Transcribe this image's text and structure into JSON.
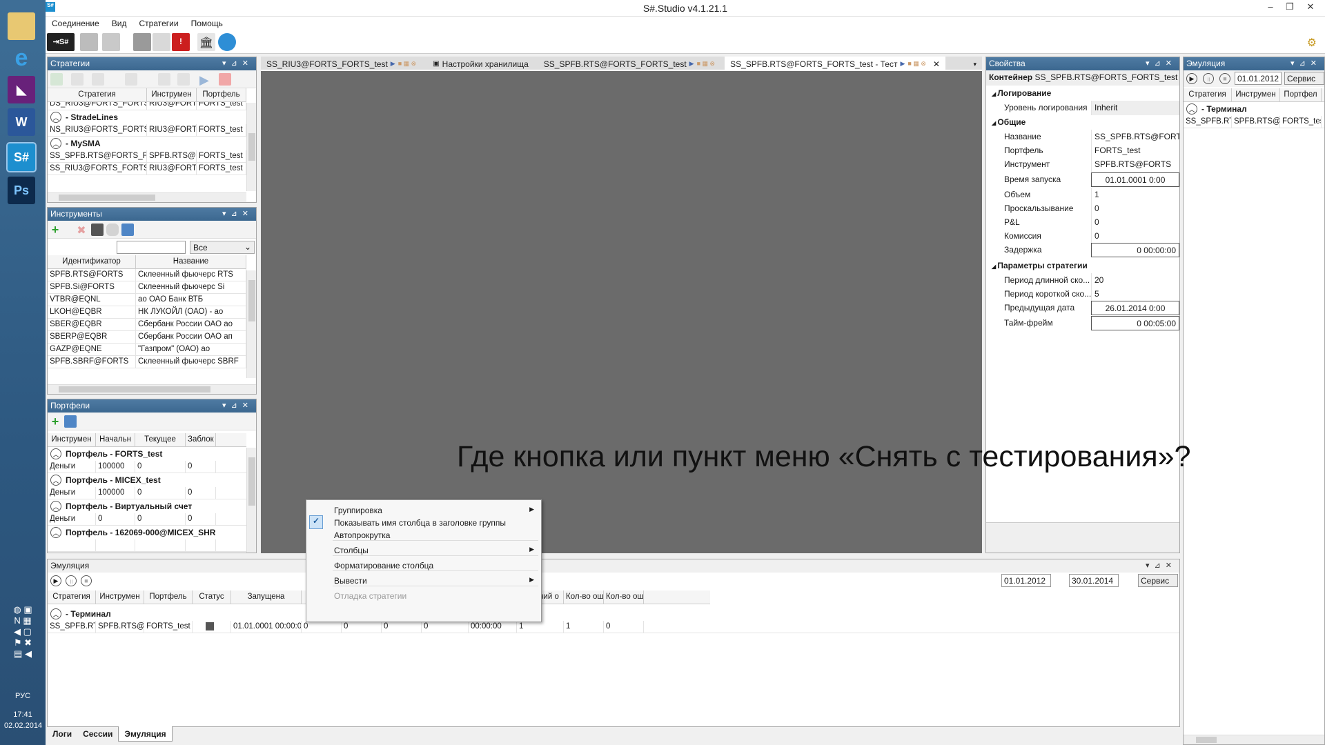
{
  "window": {
    "title": "S#.Studio v4.1.21.1"
  },
  "menu": [
    "Соединение",
    "Вид",
    "Стратегии",
    "Помощь"
  ],
  "taskbar": {
    "lang": "РУС",
    "time": "17:41",
    "date": "02.02.2014",
    "apps": [
      "file-explorer-icon",
      "ie-icon",
      "visual-studio-icon",
      "word-icon",
      "stocksharp-icon",
      "photoshop-icon"
    ],
    "app_labels": {
      "word": "W",
      "stocksharp": "S#",
      "photoshop": "Ps",
      "vs": "◣"
    }
  },
  "strategies": {
    "title": "Стратегии",
    "columns": [
      "Стратегия",
      "Инструмен",
      "Портфель"
    ],
    "rows_top": [
      [
        "DS_RIU3@FORTS_FORTS_",
        "RIU3@FORT",
        "FORTS_test"
      ]
    ],
    "groups": [
      {
        "name": "- StradeLines",
        "rows": [
          [
            "NS_RIU3@FORTS_FORTS_",
            "RIU3@FORT",
            "FORTS_test"
          ]
        ]
      },
      {
        "name": "- MySMA",
        "rows": [
          [
            "SS_SPFB.RTS@FORTS_FOF",
            "SPFB.RTS@F",
            "FORTS_test"
          ],
          [
            "SS_RIU3@FORTS_FORTS_t",
            "RIU3@FORT",
            "FORTS_test"
          ]
        ]
      }
    ]
  },
  "instruments": {
    "title": "Инструменты",
    "filter_value": "Все",
    "columns": [
      "Идентификатор",
      "Название"
    ],
    "rows": [
      [
        "SPFB.RTS@FORTS",
        "Склеенный фьючерс RTS"
      ],
      [
        "SPFB.Si@FORTS",
        "Склеенный фьючерс Si"
      ],
      [
        "VTBR@EQNL",
        "ао ОАО Банк ВТБ"
      ],
      [
        "LKOH@EQBR",
        "НК ЛУКОЙЛ (ОАО) - ао"
      ],
      [
        "SBER@EQBR",
        "Сбербанк России ОАО ао"
      ],
      [
        "SBERP@EQBR",
        "Сбербанк России ОАО ап"
      ],
      [
        "GAZP@EQNE",
        "\"Газпром\" (ОАО) ао"
      ],
      [
        "SPFB.SBRF@FORTS",
        "Склеенный фьючерс SBRF"
      ]
    ]
  },
  "portfolios": {
    "title": "Портфели",
    "columns": [
      "Инструмен",
      "Начальн",
      "Текущее",
      "Заблок"
    ],
    "groups": [
      {
        "name": "Портфель - FORTS_test",
        "row": [
          "Деньги",
          "100000",
          "0",
          "0"
        ]
      },
      {
        "name": "Портфель - MICEX_test",
        "row": [
          "Деньги",
          "100000",
          "0",
          "0"
        ]
      },
      {
        "name": "Портфель - Виртуальный счет",
        "row": [
          "Деньги",
          "0",
          "0",
          "0"
        ]
      },
      {
        "name": "Портфель - 162069-000@MICEX_SHR",
        "row": [
          "",
          "",
          "",
          ""
        ]
      }
    ]
  },
  "doc_tabs": [
    {
      "label": "SS_RIU3@FORTS_FORTS_test",
      "active": false
    },
    {
      "label": "Настройки хранилища",
      "active": false
    },
    {
      "label": "SS_SPFB.RTS@FORTS_FORTS_test",
      "active": false
    },
    {
      "label": "SS_SPFB.RTS@FORTS_FORTS_test - Тест",
      "active": true
    }
  ],
  "properties": {
    "title": "Свойства",
    "container_label": "Контейнер",
    "container_value": "SS_SPFB.RTS@FORTS_FORTS_test - Тес",
    "sections": [
      {
        "name": "Логирование",
        "items": [
          {
            "k": "Уровень логирования",
            "v": "Inherit"
          }
        ]
      },
      {
        "name": "Общие",
        "items": [
          {
            "k": "Название",
            "v": "SS_SPFB.RTS@FORTS_"
          },
          {
            "k": "Портфель",
            "v": "FORTS_test"
          },
          {
            "k": "Инструмент",
            "v": "SPFB.RTS@FORTS"
          },
          {
            "k": "Время запуска",
            "v": "01.01.0001 0:00"
          },
          {
            "k": "Объем",
            "v": "1"
          },
          {
            "k": "Проскальзывание",
            "v": "0"
          },
          {
            "k": "P&L",
            "v": "0"
          },
          {
            "k": "Комиссия",
            "v": "0"
          },
          {
            "k": "Задержка",
            "v": "0 00:00:00"
          }
        ]
      },
      {
        "name": "Параметры стратегии",
        "items": [
          {
            "k": "Период длинной ско...",
            "v": "20"
          },
          {
            "k": "Период короткой ско...",
            "v": "5"
          },
          {
            "k": "Предыдущая дата",
            "v": "26.01.2014 0:00"
          },
          {
            "k": "Тайм-фрейм",
            "v": "0 00:05:00"
          }
        ]
      }
    ]
  },
  "emul_right": {
    "title": "Эмуляция",
    "date": "01.01.2012",
    "service": "Сервис",
    "columns": [
      "Стратегия",
      "Инструмен",
      "Портфел"
    ],
    "group": "- Терминал",
    "row": [
      "SS_SPFB.RTS",
      "SPFB.RTS@F",
      "FORTS_tes"
    ]
  },
  "emul_bottom": {
    "title": "Эмуляция",
    "from": "01.01.2012",
    "to": "30.01.2014",
    "service": "Сервис",
    "columns": [
      "Стратегия",
      "Инструмен",
      "Портфель",
      "Статус",
      "Запущена",
      "",
      "",
      "",
      "",
      "ржка",
      "Рабочий о",
      "Кол-во ош",
      "Кол-во ош"
    ],
    "group": "- Терминал",
    "row": [
      "SS_SPFB.RTS",
      "SPFB.RTS@F",
      "FORTS_test",
      "",
      "01.01.0001 00:00:00",
      "0",
      "0",
      "0",
      "0",
      "00:00:00",
      "1",
      "1",
      "0"
    ]
  },
  "context_menu": {
    "items": [
      {
        "label": "Группировка",
        "submenu": true,
        "checked": false,
        "disabled": false
      },
      {
        "label": "Показывать имя столбца в заголовке группы",
        "submenu": false,
        "checked": true,
        "disabled": false
      },
      {
        "label": "Автопрокрутка",
        "submenu": false,
        "checked": false,
        "disabled": false
      },
      {
        "label": "Столбцы",
        "submenu": true,
        "checked": false,
        "disabled": false
      },
      {
        "label": "Форматирование столбца",
        "submenu": false,
        "checked": false,
        "disabled": false
      },
      {
        "label": "Вывести",
        "submenu": true,
        "checked": false,
        "disabled": false
      },
      {
        "label": "Отладка стратегии",
        "submenu": false,
        "checked": false,
        "disabled": true
      }
    ]
  },
  "bottom_tabs": [
    "Логи",
    "Сессии",
    "Эмуляция"
  ],
  "overlay_question": "Где кнопка или пункт меню «Снять с тестирования»?"
}
